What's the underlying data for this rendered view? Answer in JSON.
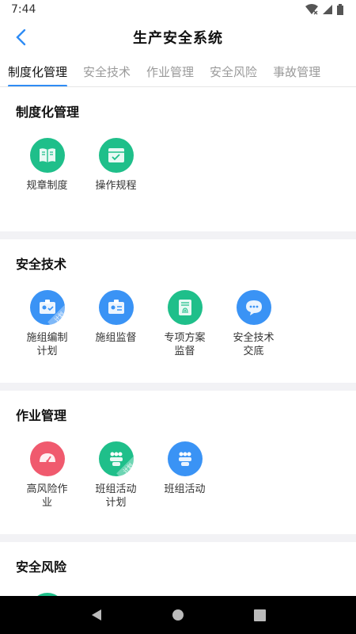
{
  "status": {
    "time": "7:44"
  },
  "header": {
    "title": "生产安全系统"
  },
  "tabs": [
    {
      "label": "制度化管理",
      "active": true
    },
    {
      "label": "安全技术",
      "active": false
    },
    {
      "label": "作业管理",
      "active": false
    },
    {
      "label": "安全风险",
      "active": false
    },
    {
      "label": "事故管理",
      "active": false
    }
  ],
  "sections": [
    {
      "title": "制度化管理",
      "items": [
        {
          "label": "规章制度",
          "icon": "book-icon",
          "color": "#1fbf8a"
        },
        {
          "label": "操作规程",
          "icon": "window-check-icon",
          "color": "#1fbf8a"
        }
      ]
    },
    {
      "title": "安全技术",
      "items": [
        {
          "label": "施组编制计划",
          "icon": "id-card-check-icon",
          "color": "#3a93f5",
          "ribbon": "计划"
        },
        {
          "label": "施组监督",
          "icon": "id-card-icon",
          "color": "#3a93f5"
        },
        {
          "label": "专项方案监督",
          "icon": "document-fingerprint-icon",
          "color": "#1fbf8a"
        },
        {
          "label": "安全技术交底",
          "icon": "chat-bubble-icon",
          "color": "#3a93f5"
        }
      ]
    },
    {
      "title": "作业管理",
      "items": [
        {
          "label": "高风险作业",
          "icon": "gauge-icon",
          "color": "#f05a6e"
        },
        {
          "label": "班组活动计划",
          "icon": "team-icon",
          "color": "#1fbf8a",
          "ribbon": "计划"
        },
        {
          "label": "班组活动",
          "icon": "team-icon",
          "color": "#3a93f5"
        }
      ]
    },
    {
      "title": "安全风险",
      "items": []
    }
  ]
}
